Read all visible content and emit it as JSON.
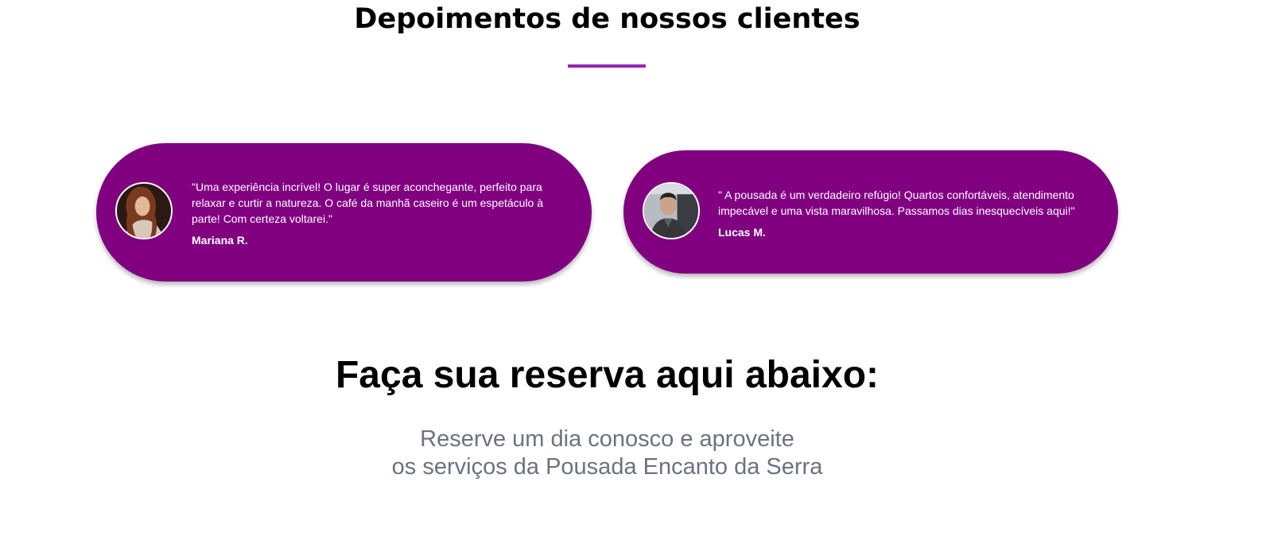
{
  "testimonials_section": {
    "title": "Depoimentos de nossos clientes",
    "accent_color": "#9e1fb8",
    "card_color": "#800080",
    "items": [
      {
        "quote": "\"Uma experiência incrível! O lugar é super aconchegante, perfeito para relaxar e curtir a natureza. O café da manhã caseiro é um espetáculo à parte! Com certeza voltarei.\"",
        "author": "Mariana R.",
        "avatar_icon": "woman-portrait-avatar"
      },
      {
        "quote": "\" A pousada é um verdadeiro refúgio! Quartos confortáveis, atendimento impecável e uma vista maravilhosa. Passamos dias inesquecíveis aqui!\"",
        "author": "Lucas M.",
        "avatar_icon": "man-portrait-avatar"
      }
    ]
  },
  "reservation_section": {
    "title": "Faça sua reserva aqui abaixo:",
    "subtitle_line1": "Reserve um dia conosco e aproveite",
    "subtitle_line2": "os serviços da Pousada Encanto da Serra",
    "subtitle_color": "#6b7280"
  }
}
